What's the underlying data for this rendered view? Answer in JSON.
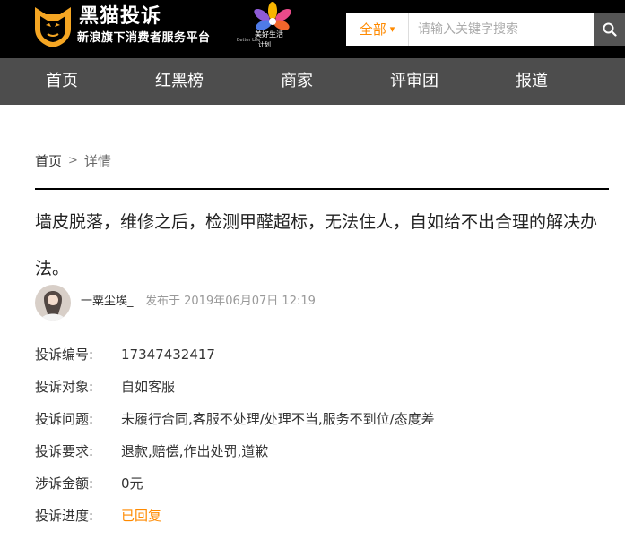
{
  "header": {
    "logo_title": "黑猫投诉",
    "logo_subtitle": "新浪旗下消费者服务平台",
    "partner_line1": "美好生活",
    "partner_line2": "Better Life",
    "partner_line3": "计划",
    "search": {
      "category": "全部",
      "placeholder": "请输入关键字搜索"
    }
  },
  "nav": {
    "items": [
      {
        "label": "首页"
      },
      {
        "label": "红黑榜"
      },
      {
        "label": "商家"
      },
      {
        "label": "评审团"
      },
      {
        "label": "报道"
      }
    ]
  },
  "breadcrumb": {
    "home": "首页",
    "separator": ">",
    "current": "详情"
  },
  "complaint": {
    "title": "墙皮脱落，维修之后，检测甲醛超标，无法住人，自如给不出合理的解决办法。",
    "author": "一粟尘埃_",
    "published": "发布于 2019年06月07日 12:19",
    "fields": [
      {
        "label": "投诉编号:",
        "value": "17347432417"
      },
      {
        "label": "投诉对象:",
        "value": "自如客服"
      },
      {
        "label": "投诉问题:",
        "value": "未履行合同,客服不处理/处理不当,服务不到位/态度差"
      },
      {
        "label": "投诉要求:",
        "value": "退款,赔偿,作出处罚,道歉"
      },
      {
        "label": "涉诉金额:",
        "value": "0元"
      },
      {
        "label": "投诉进度:",
        "value": "已回复"
      }
    ]
  },
  "colors": {
    "accent": "#ff8a00",
    "nav_bg": "#4d4d4d",
    "header_bg": "#000000"
  },
  "icons": {
    "logo": "cat-shield-icon",
    "partner": "flower-icon",
    "search": "search-icon",
    "dropdown": "caret-down-icon"
  }
}
